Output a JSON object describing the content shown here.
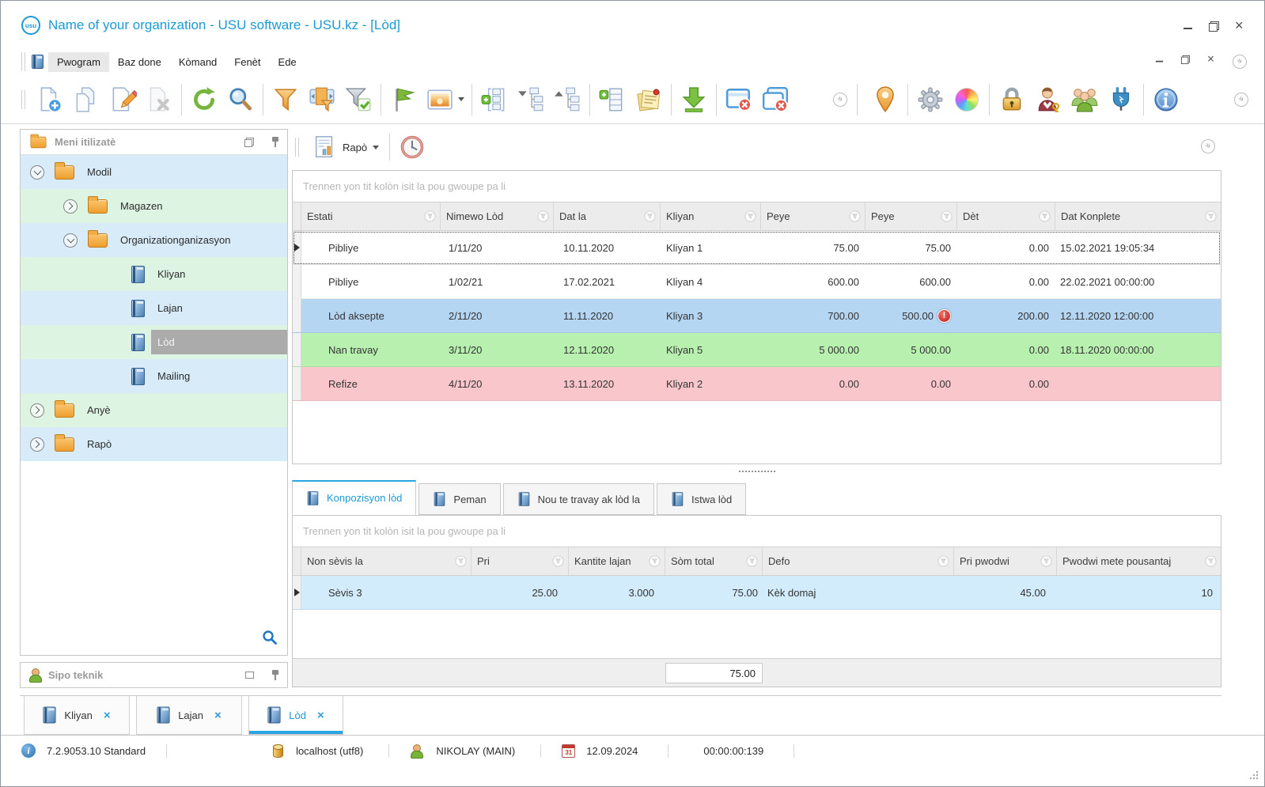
{
  "window": {
    "logo": "usu",
    "title": "Name of your organization - USU software - USU.kz - [Lòd]"
  },
  "menu": {
    "items": [
      "Pwogram",
      "Baz done",
      "Kòmand",
      "Fenèt",
      "Ede"
    ]
  },
  "toolbar": {
    "icons": [
      "new-document",
      "copy-document",
      "edit-document",
      "delete-document",
      "refresh",
      "search",
      "filter",
      "filter-settings",
      "filter-apply",
      "flag",
      "image",
      "expand-groups",
      "collapse-tree",
      "expand-tree",
      "add-row",
      "notes",
      "export",
      "close-window",
      "close-all-windows",
      "overflow-chevron",
      "location-pin",
      "settings-gear",
      "color-palette",
      "lock",
      "user-permissions",
      "user-groups",
      "plugin",
      "info"
    ]
  },
  "report_bar": {
    "label": "Rapò"
  },
  "sidebar": {
    "title": "Meni itilizatè",
    "support_title": "Sipo teknik",
    "tree": [
      {
        "label": "Modil"
      },
      {
        "label": "Magazen"
      },
      {
        "label": "Organizationganizasyon"
      },
      {
        "label": "Kliyan"
      },
      {
        "label": "Lajan"
      },
      {
        "label": "Lòd"
      },
      {
        "label": "Mailing"
      },
      {
        "label": "Anyè"
      },
      {
        "label": "Rapò"
      }
    ]
  },
  "group_hint": "Trennen yon tit kolòn isit la pou gwoupe pa li",
  "main_grid": {
    "columns": [
      "Estati",
      "Nimewo Lòd",
      "Dat la",
      "Kliyan",
      "Peye",
      "Peye",
      "Dèt",
      "Dat Konplete"
    ],
    "rows": [
      {
        "estati": "Pibliye",
        "nimewo": "1/11/20",
        "dat_la": "10.11.2020",
        "kliyan": "Kliyan 1",
        "peye1": "75.00",
        "peye2": "75.00",
        "det": "0.00",
        "konplete": "15.02.2021 19:05:34"
      },
      {
        "estati": "Pibliye",
        "nimewo": "1/02/21",
        "dat_la": "17.02.2021",
        "kliyan": "Kliyan 4",
        "peye1": "600.00",
        "peye2": "600.00",
        "det": "0.00",
        "konplete": "22.02.2021 00:00:00"
      },
      {
        "estati": "Lòd aksepte",
        "nimewo": "2/11/20",
        "dat_la": "11.11.2020",
        "kliyan": "Kliyan 3",
        "peye1": "700.00",
        "peye2": "500.00",
        "det": "200.00",
        "konplete": "12.11.2020 12:00:00"
      },
      {
        "estati": "Nan travay",
        "nimewo": "3/11/20",
        "dat_la": "12.11.2020",
        "kliyan": "Kliyan 5",
        "peye1": "5 000.00",
        "peye2": "5 000.00",
        "det": "0.00",
        "konplete": "18.11.2020 00:00:00"
      },
      {
        "estati": "Refize",
        "nimewo": "4/11/20",
        "dat_la": "13.11.2020",
        "kliyan": "Kliyan 2",
        "peye1": "0.00",
        "peye2": "0.00",
        "det": "0.00",
        "konplete": ""
      }
    ]
  },
  "detail_tabs": [
    {
      "label": "Konpozisyon lòd",
      "active": true
    },
    {
      "label": "Peman",
      "active": false
    },
    {
      "label": "Nou te travay ak lòd la",
      "active": false
    },
    {
      "label": "Istwa lòd",
      "active": false
    }
  ],
  "detail_grid": {
    "columns": [
      "Non sèvis la",
      "Pri",
      "Kantite lajan",
      "Sòm total",
      "Defo",
      "Pri pwodwi",
      "Pwodwi mete pousantaj"
    ],
    "rows": [
      {
        "non_sevis": "Sèvis 3",
        "pri": "25.00",
        "kantite": "3.000",
        "som_total": "75.00",
        "defo": "Kèk domaj",
        "pri_pwodwi": "45.00",
        "pousantaj": "10"
      }
    ],
    "total": "75.00"
  },
  "mdi_tabs": [
    {
      "label": "Kliyan",
      "active": false
    },
    {
      "label": "Lajan",
      "active": false
    },
    {
      "label": "Lòd",
      "active": true
    }
  ],
  "statusbar": {
    "version": "7.2.9053.10 Standard",
    "database": "localhost (utf8)",
    "user": "NIKOLAY (MAIN)",
    "calendar_day": "31",
    "date": "12.09.2024",
    "timer": "00:00:00:139"
  },
  "colors": {
    "accent": "#1b9ad6",
    "row_blue": "#b5d6f2",
    "row_green": "#b8f0b0",
    "row_pink": "#f9c6cb",
    "detail_row_blue": "#d2ecfb",
    "tree_row_blue": "#d8ebf9",
    "tree_row_green": "#def4e2",
    "selected_gray": "#ababab",
    "warning_red": "#c11818"
  }
}
